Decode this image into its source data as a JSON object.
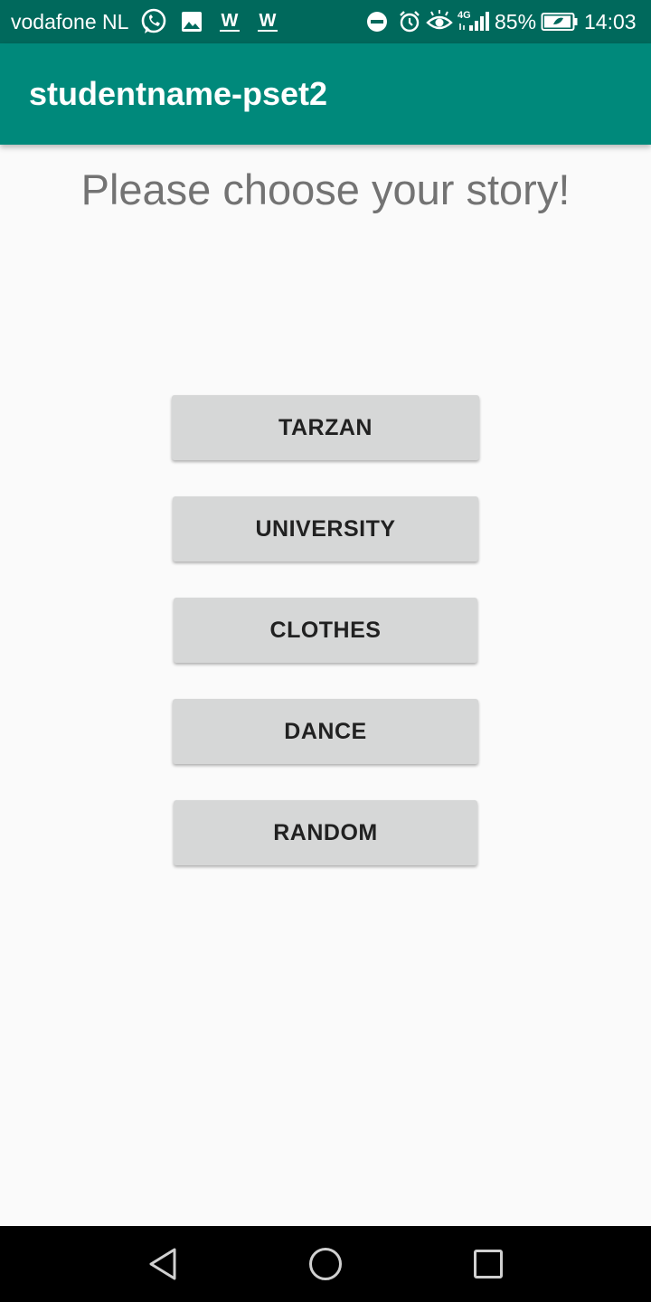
{
  "status_bar": {
    "carrier": "vodafone NL",
    "network_type": "4G",
    "battery": "85%",
    "time": "14:03",
    "notification_icons": [
      "whatsapp-icon",
      "image-icon",
      "w-icon",
      "w-icon"
    ],
    "system_icons": [
      "do-not-disturb-icon",
      "alarm-icon",
      "eye-icon",
      "signal-icon",
      "battery-icon"
    ]
  },
  "app_bar": {
    "title": "studentname-pset2"
  },
  "main": {
    "prompt": "Please choose your story!",
    "stories": [
      {
        "label": "TARZAN"
      },
      {
        "label": "UNIVERSITY"
      },
      {
        "label": "CLOTHES"
      },
      {
        "label": "DANCE"
      },
      {
        "label": "RANDOM"
      }
    ]
  },
  "nav_bar": {
    "buttons": [
      "back-icon",
      "home-icon",
      "recents-icon"
    ]
  },
  "colors": {
    "status_bar": "#00695c",
    "app_bar": "#00897b",
    "background": "#fafafa",
    "button": "#d6d7d7",
    "button_text": "#212121",
    "prompt_text": "#737373"
  }
}
